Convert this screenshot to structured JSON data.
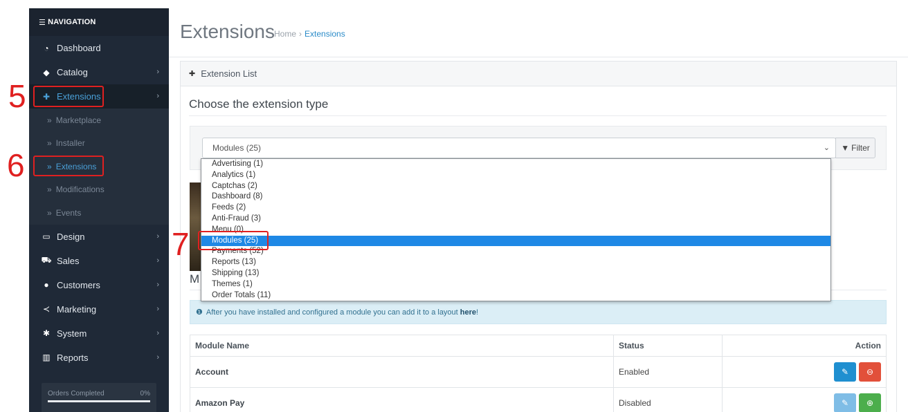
{
  "sidebar": {
    "header": "NAVIGATION",
    "items": [
      {
        "label": "Dashboard",
        "icon": "dashboard-icon"
      },
      {
        "label": "Catalog",
        "icon": "tag-icon"
      },
      {
        "label": "Extensions",
        "icon": "puzzle-icon"
      },
      {
        "label": "Design",
        "icon": "monitor-icon"
      },
      {
        "label": "Sales",
        "icon": "cart-icon"
      },
      {
        "label": "Customers",
        "icon": "user-icon"
      },
      {
        "label": "Marketing",
        "icon": "share-icon"
      },
      {
        "label": "System",
        "icon": "gear-icon"
      },
      {
        "label": "Reports",
        "icon": "bar-chart-icon"
      }
    ],
    "subitems": [
      "Marketplace",
      "Installer",
      "Extensions",
      "Modifications",
      "Events"
    ],
    "progress": {
      "label": "Orders Completed",
      "percent": "0%"
    }
  },
  "annotations": [
    "5",
    "6",
    "7"
  ],
  "header": {
    "title": "Extensions",
    "breadcrumb": [
      "Home",
      "Extensions"
    ]
  },
  "panel": {
    "title": "Extension List",
    "choose_title": "Choose the extension type",
    "select_value": "Modules (25)",
    "filter_label": "Filter",
    "section_fragment": "M",
    "alert_text": "After you have installed and configured a module you can add it to a layout",
    "alert_link": "here",
    "alert_end": "!"
  },
  "dropdown": {
    "options": [
      "Advertising (1)",
      "Analytics (1)",
      "Captchas (2)",
      "Dashboard (8)",
      "Feeds (2)",
      "Anti-Fraud (3)",
      "Menu (0)",
      "Modules (25)",
      "Payments (52)",
      "Reports (13)",
      "Shipping (13)",
      "Themes (1)",
      "Order Totals (11)"
    ],
    "selected_index": 7
  },
  "table": {
    "headers": [
      "Module Name",
      "Status",
      "Action"
    ],
    "rows": [
      {
        "name": "Account",
        "status": "Enabled"
      },
      {
        "name": "Amazon Pay",
        "status": "Disabled"
      }
    ]
  },
  "colors": {
    "sidebar": "#1f2937",
    "accent": "#1e88e5",
    "annotation": "#e02020"
  }
}
